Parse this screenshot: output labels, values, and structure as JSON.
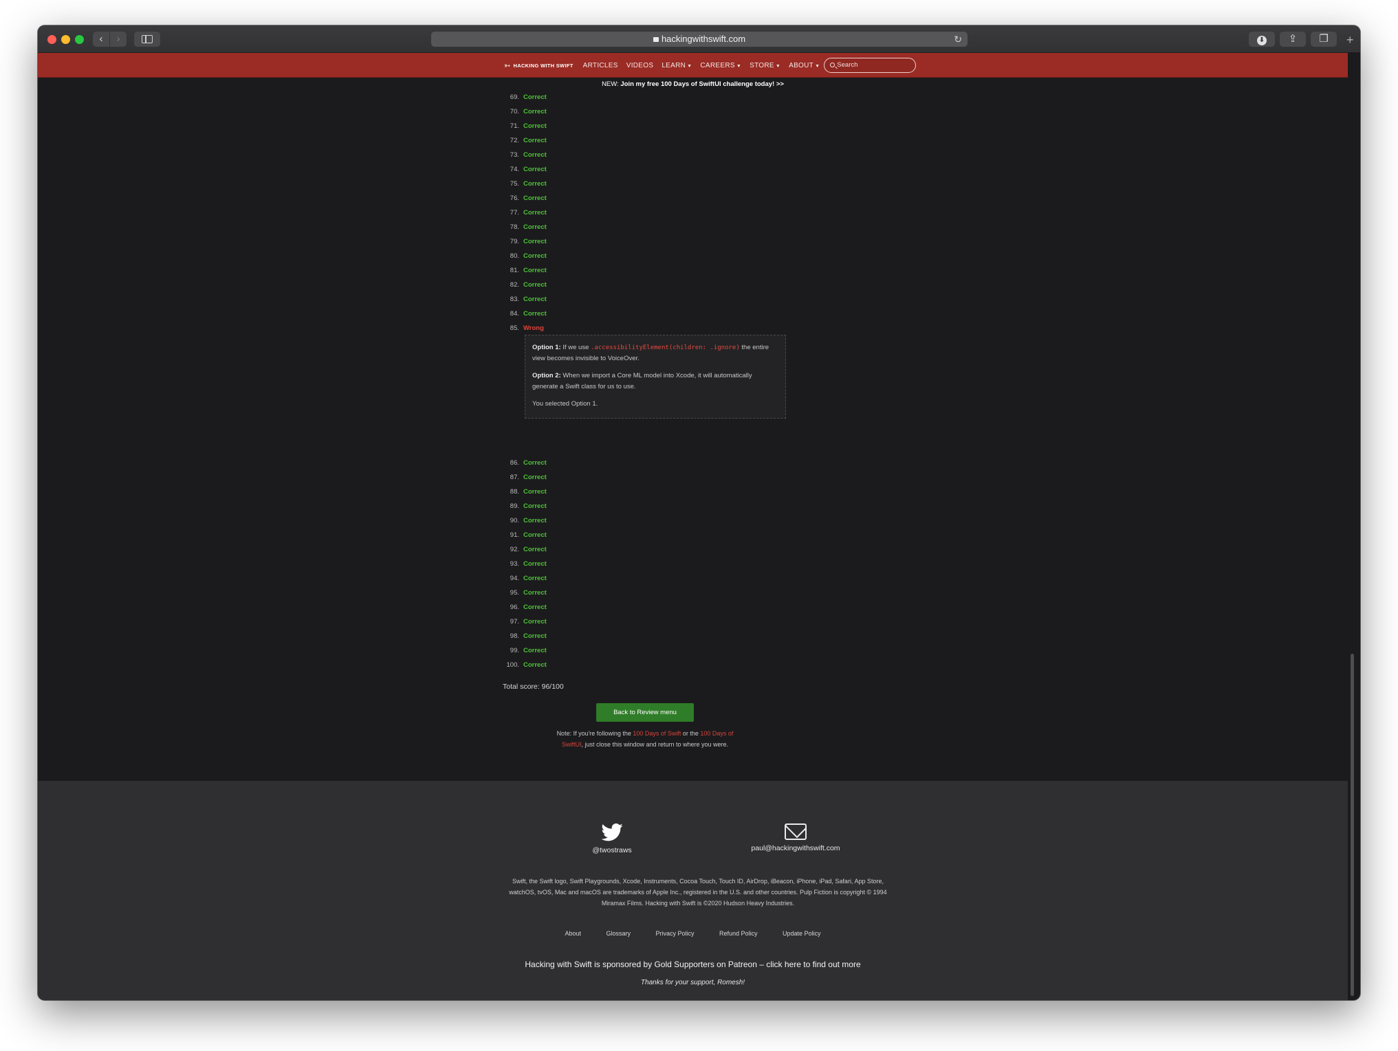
{
  "browser": {
    "url": "hackingwithswift.com",
    "back_icon": "‹",
    "forward_icon": "›",
    "reload_icon": "↻",
    "download_icon": "⬇",
    "share_icon": "⇪",
    "tabs_icon": "❐",
    "newtab_icon": "+"
  },
  "nav": {
    "logo_text": "HACKING WITH SWIFT",
    "items": [
      {
        "label": "ARTICLES",
        "dropdown": false
      },
      {
        "label": "VIDEOS",
        "dropdown": false
      },
      {
        "label": "LEARN",
        "dropdown": true
      },
      {
        "label": "CAREERS",
        "dropdown": true
      },
      {
        "label": "STORE",
        "dropdown": true
      },
      {
        "label": "ABOUT",
        "dropdown": true
      }
    ],
    "search_placeholder": "Search",
    "accent_color": "#9a2b25"
  },
  "banner": {
    "prefix": "NEW: ",
    "text": "Join my free 100 Days of SwiftUI challenge today! >>"
  },
  "results_before": [
    {
      "num": "69.",
      "status": "Correct"
    },
    {
      "num": "70.",
      "status": "Correct"
    },
    {
      "num": "71.",
      "status": "Correct"
    },
    {
      "num": "72.",
      "status": "Correct"
    },
    {
      "num": "73.",
      "status": "Correct"
    },
    {
      "num": "74.",
      "status": "Correct"
    },
    {
      "num": "75.",
      "status": "Correct"
    },
    {
      "num": "76.",
      "status": "Correct"
    },
    {
      "num": "77.",
      "status": "Correct"
    },
    {
      "num": "78.",
      "status": "Correct"
    },
    {
      "num": "79.",
      "status": "Correct"
    },
    {
      "num": "80.",
      "status": "Correct"
    },
    {
      "num": "81.",
      "status": "Correct"
    },
    {
      "num": "82.",
      "status": "Correct"
    },
    {
      "num": "83.",
      "status": "Correct"
    },
    {
      "num": "84.",
      "status": "Correct"
    },
    {
      "num": "85.",
      "status": "Wrong"
    }
  ],
  "explanation": {
    "option1_label": "Option 1:",
    "option1_pre": " If we use ",
    "option1_code": ".accessibilityElement(children: .ignore)",
    "option1_post": " the entire view becomes invisible to VoiceOver.",
    "option2_label": "Option 2:",
    "option2_text": " When we import a Core ML model into Xcode, it will automatically generate a Swift class for us to use.",
    "selected": "You selected Option 1."
  },
  "results_after": [
    {
      "num": "86.",
      "status": "Correct"
    },
    {
      "num": "87.",
      "status": "Correct"
    },
    {
      "num": "88.",
      "status": "Correct"
    },
    {
      "num": "89.",
      "status": "Correct"
    },
    {
      "num": "90.",
      "status": "Correct"
    },
    {
      "num": "91.",
      "status": "Correct"
    },
    {
      "num": "92.",
      "status": "Correct"
    },
    {
      "num": "93.",
      "status": "Correct"
    },
    {
      "num": "94.",
      "status": "Correct"
    },
    {
      "num": "95.",
      "status": "Correct"
    },
    {
      "num": "96.",
      "status": "Correct"
    },
    {
      "num": "97.",
      "status": "Correct"
    },
    {
      "num": "98.",
      "status": "Correct"
    },
    {
      "num": "99.",
      "status": "Correct"
    },
    {
      "num": "100.",
      "status": "Correct"
    }
  ],
  "total_score": "Total score: 96/100",
  "back_button": "Back to Review menu",
  "note": {
    "part1": "Note: If you're following the ",
    "link1": "100 Days of Swift",
    "part2": " or the ",
    "link2": "100 Days of SwiftUI",
    "part3": ", just close this window and return to where you were."
  },
  "footer": {
    "twitter_icon": "twitter-bird",
    "twitter": "@twostraws",
    "mail_icon": "envelope",
    "email": "paul@hackingwithswift.com",
    "legal": "Swift, the Swift logo, Swift Playgrounds, Xcode, Instruments, Cocoa Touch, Touch ID, AirDrop, iBeacon, iPhone, iPad, Safari, App Store, watchOS, tvOS, Mac and macOS are trademarks of Apple Inc., registered in the U.S. and other countries. Pulp Fiction is copyright © 1994 Miramax Films. Hacking with Swift is ©2020 Hudson Heavy Industries.",
    "links": [
      "About",
      "Glossary",
      "Privacy Policy",
      "Refund Policy",
      "Update Policy"
    ],
    "sponsor": "Hacking with Swift is sponsored by Gold Supporters on Patreon – click here to find out more",
    "thanks": "Thanks for your support, Romesh!"
  },
  "colors": {
    "correct": "#4fc13a",
    "wrong": "#e0443a",
    "button": "#2f7d28"
  }
}
